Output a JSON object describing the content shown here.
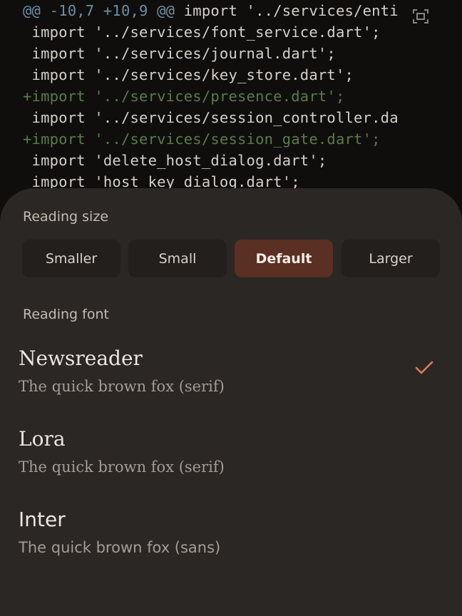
{
  "diff": {
    "hunk": {
      "marker": "@@ -10,7 +10,9 @@",
      "rest": " import '../services/enti"
    },
    "lines": [
      {
        "type": "ctx",
        "text": " import '../services/font_service.dart';"
      },
      {
        "type": "ctx",
        "text": " import '../services/journal.dart';"
      },
      {
        "type": "ctx",
        "text": " import '../services/key_store.dart';"
      },
      {
        "type": "add",
        "text": "+import '../services/presence.dart';"
      },
      {
        "type": "ctx",
        "text": " import '../services/session_controller.da"
      },
      {
        "type": "add",
        "text": "+import '../services/session_gate.dart';"
      },
      {
        "type": "ctx",
        "text": " import 'delete_host_dialog.dart';"
      },
      {
        "type": "ctx",
        "text": " import 'host_key_dialog.dart';"
      }
    ],
    "expand_icon": "expand-icon"
  },
  "sheet": {
    "size_label": "Reading size",
    "sizes": [
      "Smaller",
      "Small",
      "Default",
      "Larger"
    ],
    "selected_size": "Default",
    "font_label": "Reading font",
    "fonts": [
      {
        "name": "Newsreader",
        "sample": "The quick brown fox (serif)",
        "selected": true
      },
      {
        "name": "Lora",
        "sample": "The quick brown fox (serif)",
        "selected": false
      },
      {
        "name": "Inter",
        "sample": "The quick brown fox (sans)",
        "selected": false
      }
    ],
    "check_icon": "check-icon"
  },
  "colors": {
    "sheet_bg": "#2b2724",
    "accent": "#e07a5a",
    "selected_size_bg": "#5a3022",
    "added_line": "#5c7a48",
    "hunk_header": "#6d8ea6"
  }
}
